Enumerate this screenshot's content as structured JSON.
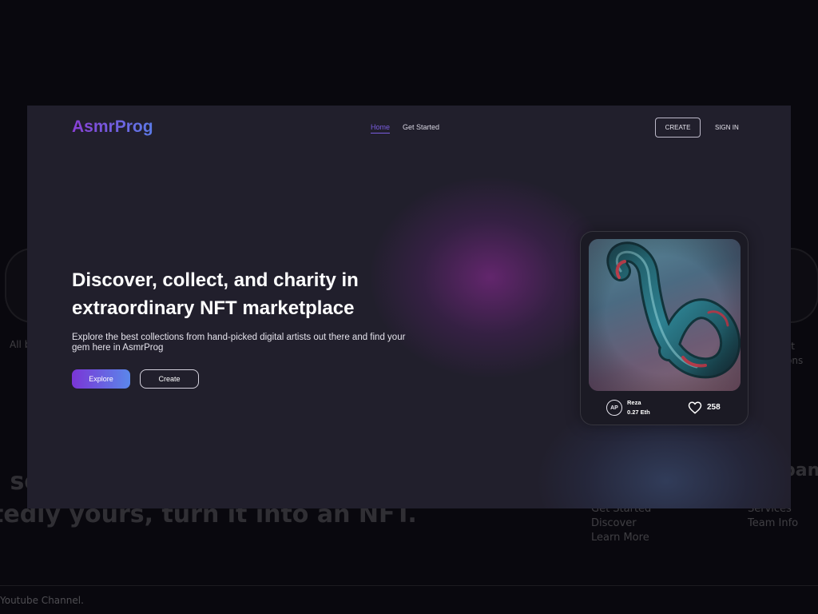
{
  "background": {
    "left_small_text": "All b",
    "right_small_text_1": "st",
    "right_small_text_2": "ons",
    "heading_line1": ": so",
    "heading_line2": "tedly yours, turn it into an NFT.",
    "column_heading": "pan",
    "links_col1": [
      "Get Started",
      "Discover",
      "Learn More"
    ],
    "links_col2": [
      "Services",
      "Team Info"
    ],
    "footer_text": "Youtube Channel."
  },
  "header": {
    "logo": "AsmrProg",
    "nav": [
      {
        "label": "Home",
        "active": true
      },
      {
        "label": "Get Started",
        "active": false
      }
    ],
    "create_label": "CREATE",
    "signin_label": "SIGN IN"
  },
  "hero": {
    "title": "Discover, collect, and charity in extraordinary NFT marketplace",
    "subtitle": "Explore the best collections from hand-picked digital artists out there and find your gem here in AsmrProg",
    "explore_label": "Explore",
    "create_label": "Create"
  },
  "nft_card": {
    "avatar_initials": "AP",
    "owner": "Reza",
    "price": "0.27 Eth",
    "likes": "258",
    "icon": "heart-icon"
  },
  "colors": {
    "panel_bg": "#211f2c",
    "accent_purple": "#7a35d6",
    "accent_blue": "#5b87ea",
    "nav_active": "#7a5de0"
  }
}
